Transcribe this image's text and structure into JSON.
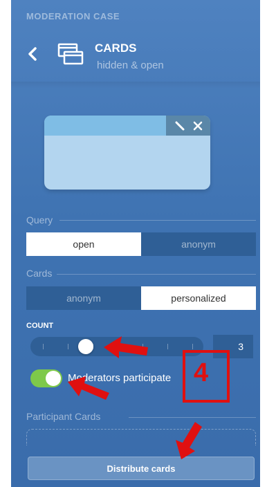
{
  "header": {
    "case_title": "MODERATION CASE",
    "mode_title": "CARDS",
    "mode_subtitle": "hidden & open"
  },
  "card_preview": {
    "tools": [
      "edit-icon",
      "close-icon"
    ]
  },
  "query": {
    "label": "Query",
    "options": [
      "open",
      "anonym"
    ],
    "selected": "open"
  },
  "cards": {
    "label": "Cards",
    "options": [
      "anonym",
      "personalized"
    ],
    "selected": "personalized"
  },
  "count": {
    "label": "COUNT",
    "value": "3",
    "min": 1,
    "max": 8
  },
  "moderators": {
    "label": "Moderators participate",
    "enabled": true
  },
  "participant_cards": {
    "label": "Participant Cards"
  },
  "actions": {
    "distribute_label": "Distribute cards"
  },
  "annotation": {
    "number": "4",
    "color": "#e01010"
  },
  "colors": {
    "panel": "#4579b8",
    "segment_off": "#2f5f96",
    "toggle_on": "#7ec94a",
    "card": "#b3d5ef",
    "card_header": "#7fbde5"
  }
}
